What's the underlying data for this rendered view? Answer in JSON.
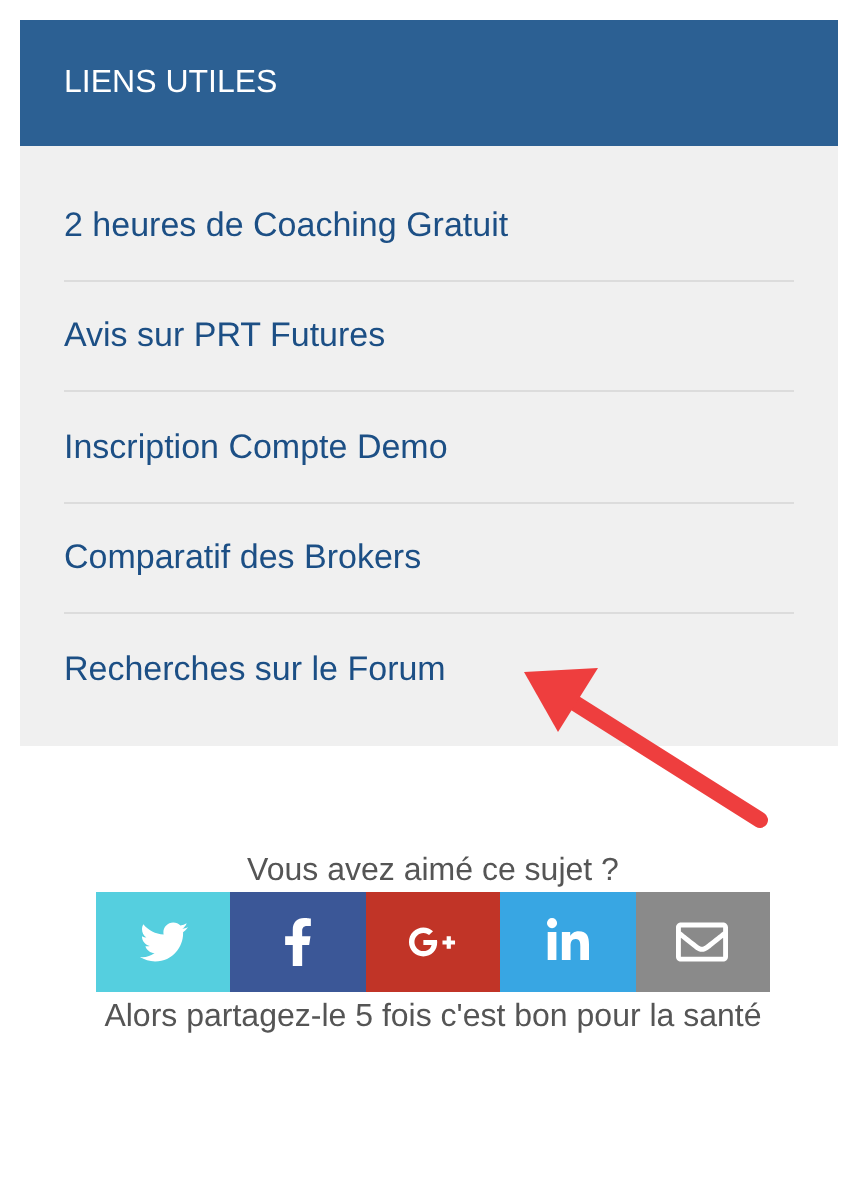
{
  "panel": {
    "title": "LIENS UTILES",
    "links": [
      {
        "label": "2 heures de Coaching Gratuit"
      },
      {
        "label": "Avis sur PRT Futures"
      },
      {
        "label": "Inscription Compte Demo"
      },
      {
        "label": "Comparatif des Brokers"
      },
      {
        "label": "Recherches sur le Forum"
      }
    ]
  },
  "share": {
    "question": "Vous avez aimé ce sujet ?",
    "buttons": [
      {
        "kind": "twitter",
        "color": "#55cfdf"
      },
      {
        "kind": "facebook",
        "color": "#3b5797"
      },
      {
        "kind": "googleplus",
        "color": "#c13427"
      },
      {
        "kind": "linkedin",
        "color": "#38a6e3"
      },
      {
        "kind": "email",
        "color": "#8a8a8a"
      }
    ],
    "footer": "Alors partagez-le 5 fois c'est bon pour la santé"
  }
}
